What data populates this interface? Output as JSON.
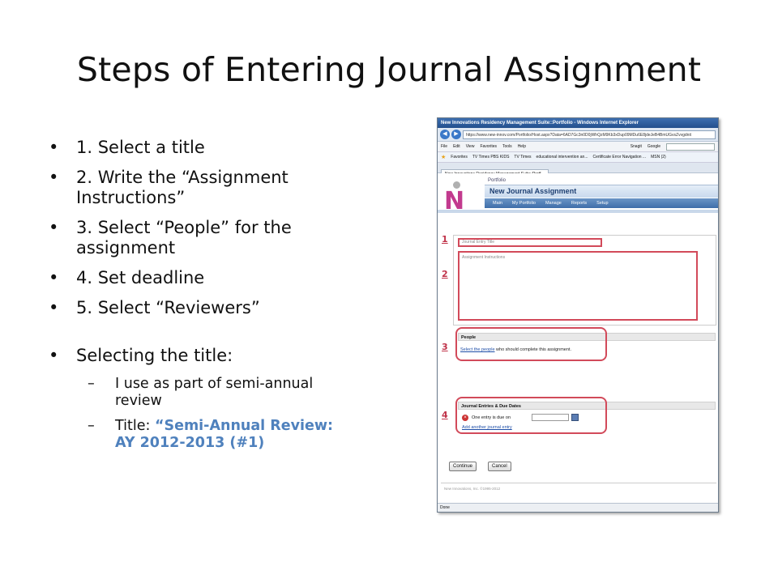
{
  "slide": {
    "title": "Steps of Entering Journal Assignment",
    "bullets": [
      "1. Select a title",
      "2. Write the “Assignment Instructions”",
      "3. Select “People” for the assignment",
      "4. Set deadline",
      "5. Select “Reviewers”"
    ],
    "selecting": {
      "heading": "Selecting the title:",
      "sub1": "I use as part of semi-annual review",
      "sub2_prefix": "Title: ",
      "sub2_highlight": "“Semi-Annual Review: AY 2012-2013 (#1)"
    }
  },
  "browser": {
    "window_title": "New Innovations Residency Management Suite::Portfolio - Windows Internet Explorer",
    "address": "https://www.new-innov.com/Portfolio/Host.aspx?Data=6AD7Gc3n0D0jWhQzM9Kb3xDup09MDu6E8jdeJeB4BmUGvsZvvgdnit",
    "menu": [
      "File",
      "Edit",
      "View",
      "Favorites",
      "Tools",
      "Help"
    ],
    "snagit": "Snagit",
    "google": "Google",
    "favorites_label": "Favorites",
    "favorites": [
      "TV Times PBS KIDS",
      "TV Times",
      "educational intervention an...",
      "Certificate Error Navigation ...",
      "MSN (2)"
    ],
    "tab": "New Innovations Residency Management Suite::Portf...",
    "status": "Done",
    "colors": {
      "titlebar": "#2f5f9e",
      "highlight_border": "#d24a5a",
      "link": "#1f4fa8"
    }
  },
  "app": {
    "breadcrumb": "Portfolio",
    "header": "New Journal Assignment",
    "nav": [
      "Main",
      "My Portfolio",
      "Manage",
      "Reports",
      "Setup"
    ],
    "title_placeholder": "Journal Entry Title",
    "instructions_placeholder": "Assignment Instructions",
    "people_header": "People",
    "people_link": "Select the people",
    "people_rest": " who should complete this assignment.",
    "journal_header": "Journal Entries & Due Dates",
    "due_text": "One entry is due on",
    "add_link": "Add another journal entry",
    "continue": "Continue",
    "cancel": "Cancel",
    "footer": "New Innovations, Inc. ©1995-2012",
    "step_numbers": [
      "1",
      "2",
      "3",
      "4"
    ]
  }
}
